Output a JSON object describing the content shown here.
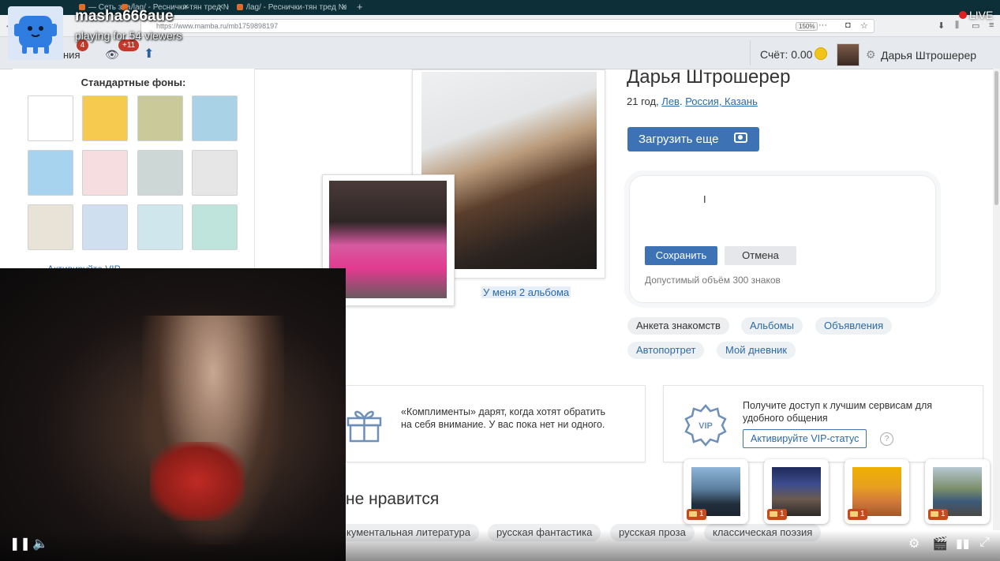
{
  "stream": {
    "streamer": "masha666aue",
    "subtitle": "playing for 54 viewers",
    "live": "LIVE"
  },
  "browser": {
    "tabs": [
      "— Сеть зна",
      "/lag/ - Реснички-тян тред №",
      "/lag/ - Реснички-тян тред №"
    ],
    "url": "https://www.mamba.ru/mb1759898197",
    "zoom": "150%"
  },
  "header": {
    "partial_label": "ния",
    "messages_badge": "4",
    "views_badge": "+11",
    "score": "Счёт: 0.00",
    "user_name": "Дарья Штрошерер"
  },
  "backgrounds": {
    "title": "Стандартные фоны:",
    "swatch_colors": [
      "#ffffff",
      "#f6c94f",
      "#c9c99a",
      "#a9d2e6",
      "#a8d3ef",
      "#f6dde0",
      "#cdd8d6",
      "#e6e6e6",
      "#e9e2d6",
      "#cfdff0",
      "#cfe6ec",
      "#bfe4dc"
    ],
    "vip_link": "Активируйте VIP"
  },
  "photos": {
    "albums_link": "У меня 2 альбома"
  },
  "profile": {
    "name": "Дарья Штрошерер",
    "age": "21 год, ",
    "zodiac": "Лев",
    "location": "Россия, Казань",
    "upload_button": "Загрузить еще",
    "save_button": "Сохранить",
    "cancel_button": "Отмена",
    "limit_text": "Допустимый объём 300 знаков",
    "tabs": [
      "Анкета знакомств",
      "Альбомы",
      "Объявления",
      "Автопортрет",
      "Мой дневник"
    ]
  },
  "compliments": {
    "text": "«Комплименты» дарят, когда хотят обратить на себя внимание. У вас пока нет ни одного."
  },
  "vip": {
    "badge": "VIP",
    "text": "Получите доступ к лучшим сервисам для удобного общения",
    "button": "Активируйте VIP-статус",
    "help": "?"
  },
  "likes": {
    "title": "не нравится",
    "interests": [
      "кументальная литература",
      "русская фантастика",
      "русская проза",
      "классическая поэзия"
    ]
  },
  "notifications": [
    {
      "count": "1"
    },
    {
      "count": "1"
    },
    {
      "count": "1"
    },
    {
      "count": "1"
    }
  ]
}
